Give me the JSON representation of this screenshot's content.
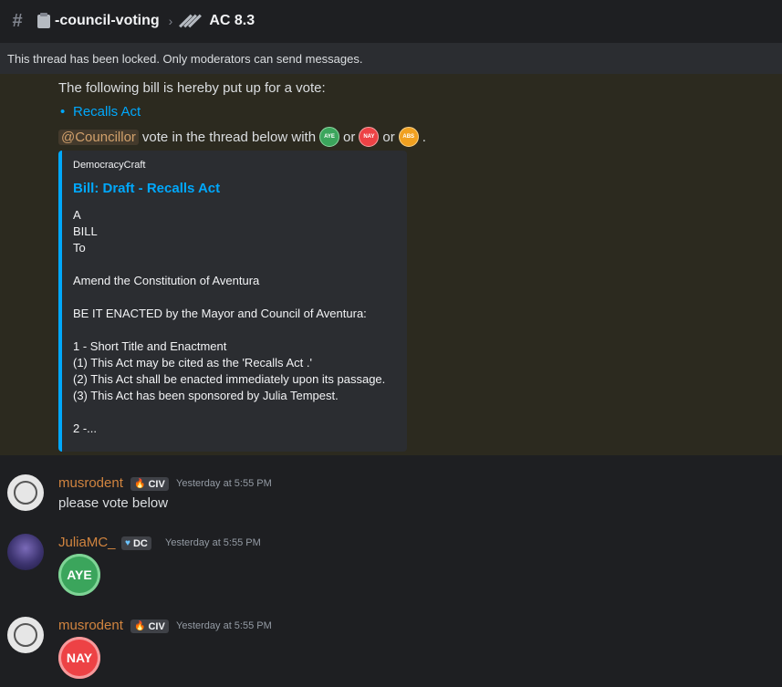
{
  "header": {
    "channel": "-council-voting",
    "thread_title": "AC 8.3"
  },
  "locked_notice": "This thread has been locked. Only moderators can send messages.",
  "starter": {
    "intro": "The following bill is hereby put up for a vote:",
    "bill_link": "Recalls Act",
    "mention": "@Councillor",
    "vote_text": "vote in the thread below with",
    "or_text": "or",
    "period": ".",
    "badges": {
      "aye": "AYE",
      "nay": "NAY",
      "abs": "ABS"
    }
  },
  "embed": {
    "provider": "DemocracyCraft",
    "title": "Bill: Draft - Recalls Act",
    "lines": [
      "A",
      "BILL",
      "To",
      "",
      "Amend the Constitution of Aventura",
      "",
      "BE IT ENACTED by the Mayor and Council of Aventura:",
      "",
      "1 - Short Title and Enactment",
      "(1) This Act may be cited as the 'Recalls Act .'",
      "(2) This Act shall be enacted immediately upon its passage.",
      "(3) This Act has been sponsored by Julia Tempest.",
      "",
      "2 -..."
    ]
  },
  "messages": [
    {
      "username": "musrodent",
      "tag": "CIV",
      "time": "Yesterday at 5:55 PM",
      "text": "please vote below"
    },
    {
      "username": "JuliaMC_",
      "tag": "DC",
      "time": "Yesterday at 5:55 PM",
      "badge": "AYE"
    },
    {
      "username": "musrodent",
      "tag": "CIV",
      "time": "Yesterday at 5:55 PM",
      "badge": "NAY"
    }
  ],
  "colors": {
    "background": "#1e1f22",
    "accent_link": "#00a8fc",
    "username": "#d1843f",
    "aye": "#3ba55c",
    "nay": "#ed4245",
    "abs": "#f0a020"
  }
}
